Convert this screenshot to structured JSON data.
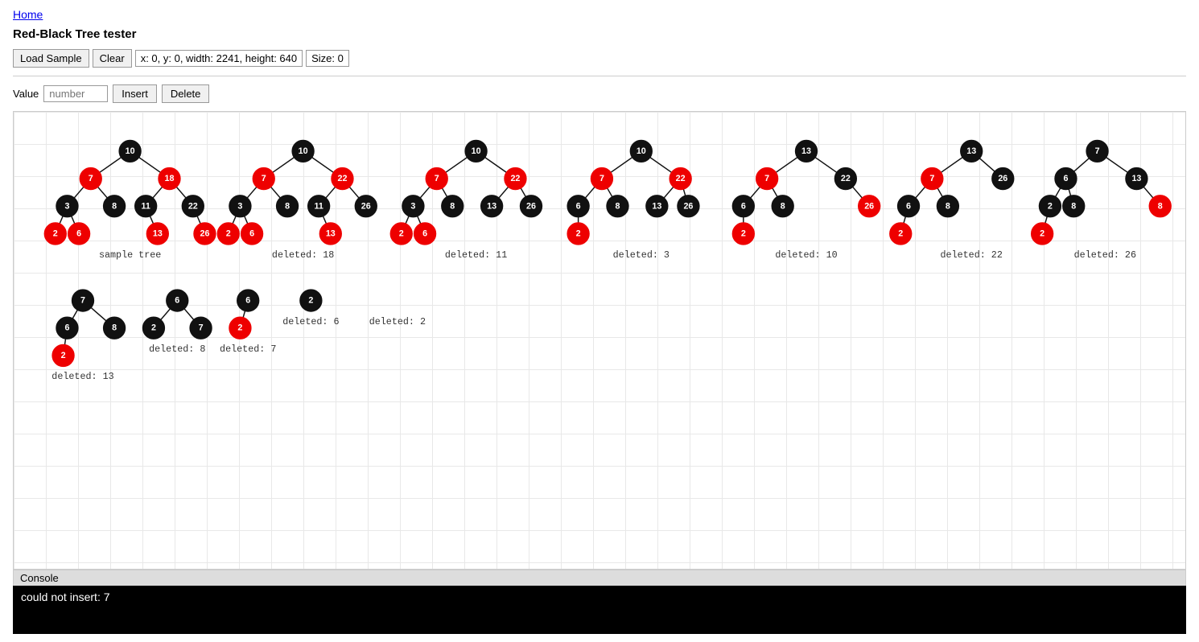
{
  "nav": {
    "home_link": "Home"
  },
  "header": {
    "title": "Red-Black Tree tester"
  },
  "toolbar": {
    "load_sample_label": "Load Sample",
    "clear_label": "Clear",
    "info_text": "x: 0, y: 0, width: 2241, height: 640",
    "size_text": "Size: 0"
  },
  "value_row": {
    "label": "Value",
    "placeholder": "number",
    "insert_label": "Insert",
    "delete_label": "Delete"
  },
  "console": {
    "label": "Console",
    "message": "could not insert: 7"
  }
}
